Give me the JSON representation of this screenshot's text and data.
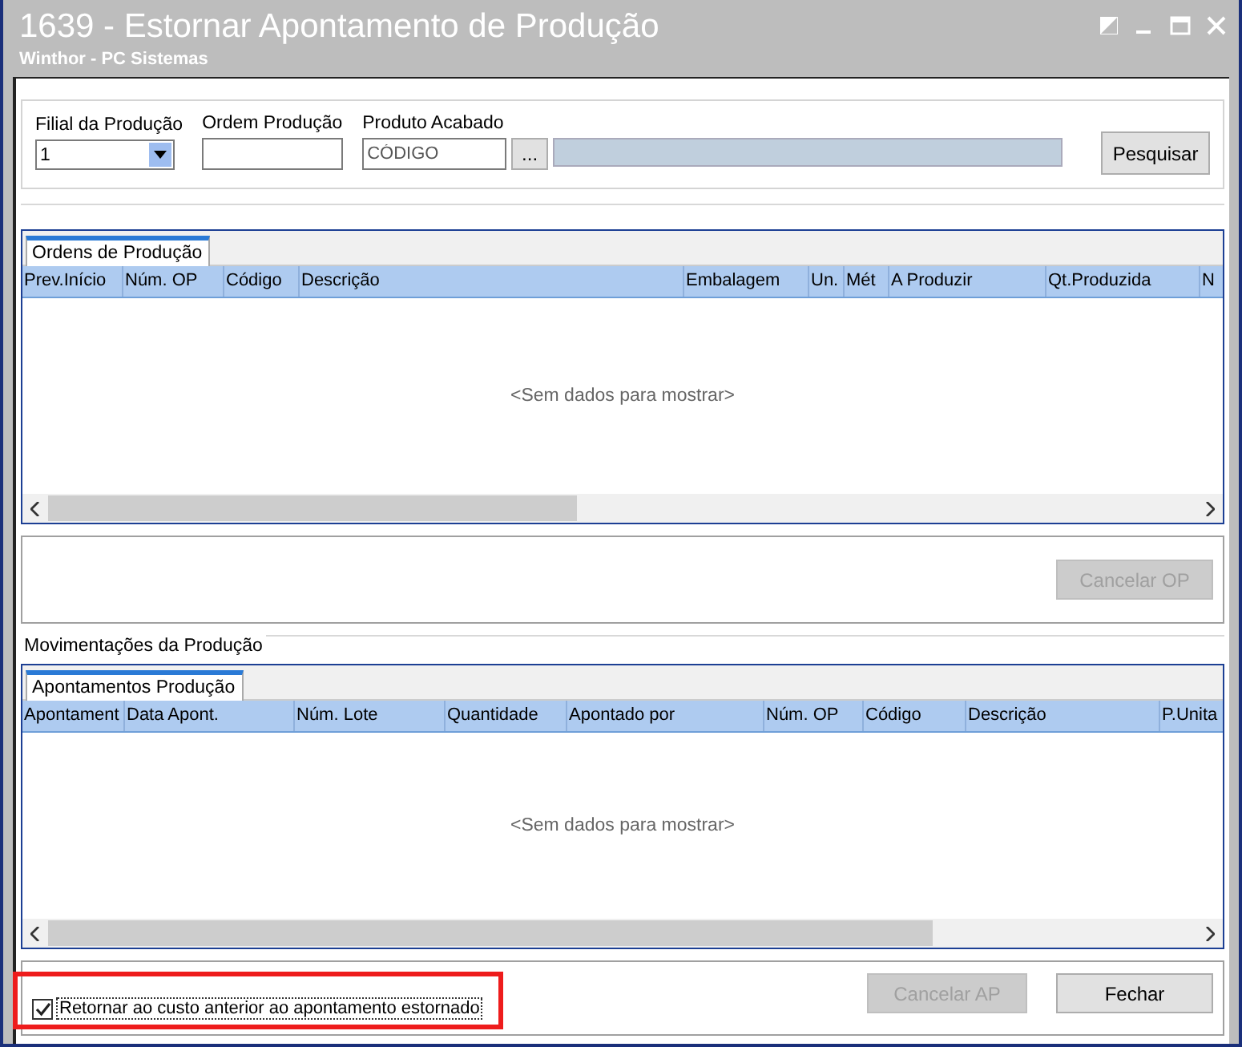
{
  "window": {
    "title": "1639 - Estornar Apontamento de Produção",
    "subtitle": "Winthor - PC Sistemas"
  },
  "filters": {
    "branch": {
      "label": "Filial da Produção",
      "value": "1"
    },
    "order": {
      "label": "Ordem Produção"
    },
    "product": {
      "label": "Produto Acabado",
      "placeholder": "CÓDIGO",
      "lookup_button": "..."
    },
    "search_button": "Pesquisar"
  },
  "orders_grid": {
    "tabs": [
      {
        "label": "Ordens de Produção",
        "selected": true
      }
    ],
    "columns": [
      "Prev.Início",
      "Núm. OP",
      "Código",
      "Descrição",
      "Embalagem",
      "Un.",
      "Mét",
      "A Produzir",
      "Qt.Produzida",
      "N"
    ],
    "empty_text": "<Sem dados para mostrar>"
  },
  "cancel_op_button": {
    "label": "Cancelar OP",
    "disabled": true
  },
  "movements": {
    "label": "Movimentações da Produção",
    "grid": {
      "tabs": [
        {
          "label": "Apontamentos Produção",
          "selected": true
        }
      ],
      "columns": [
        "Apontament",
        "Data Apont.",
        "Núm. Lote",
        "Quantidade",
        "Apontado por",
        "Núm. OP",
        "Código",
        "Descrição",
        "P.Unita"
      ],
      "empty_text": "<Sem dados para mostrar>"
    }
  },
  "footer": {
    "option": {
      "label": "Retornar ao custo anterior ao apontamento estornado",
      "checked": true,
      "highlighted": true
    },
    "buttons": [
      {
        "label": "Cancelar AP",
        "disabled": true
      },
      {
        "label": "Fechar",
        "disabled": false
      }
    ]
  }
}
